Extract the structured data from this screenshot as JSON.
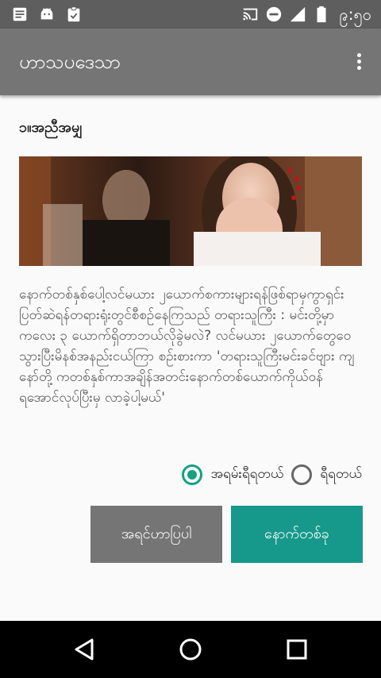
{
  "status_bar": {
    "time": "၉:၅၀",
    "icons_left": [
      "notes-icon",
      "android-icon",
      "clipboard-check-icon"
    ],
    "icons_right": [
      "cast-icon",
      "do-not-disturb-icon",
      "signal-icon",
      "battery-icon"
    ]
  },
  "app_bar": {
    "title": "ဟာသပဒေသာ",
    "menu_icon": "more-vert-icon"
  },
  "lesson": {
    "title": "၁။အညီအမျှ",
    "story": "နောက်တစ်နှစ်ပေါ့လင်မယား ၂ယောက်စကားများရန်ဖြစ်ရာမှကွာရှင်းပြတ်ဆဲရန်တရားရုံးတွင်စီစဥ်နေကြသည် တရားသူကြီး : မင်းတို့မှာကလေး ၃ ယောက်ရှိတာဘယ်လိုခွဲမလဲ? လင်မယား ၂ယောက်တွေဝေသွားပြီးမိနစ်အနည်းငယ်ကြာ စဥ်းစားကာ 'တရားသူကြီးမင်းခင်ဗျား ကျနော်တို့ ကတစ်နှစ်ကာအချိန်အတင်းနောက်တစ်ယောက်ကိုယ်ဝန်ရအောင်လုပ်ပြီးမှ လာခဲ့ပါ့မယ်'"
  },
  "choices": {
    "option1": "အရမ်းရီရတယ်",
    "option2": "ရီရတယ်",
    "selected": "option1"
  },
  "buttons": {
    "previous": "အရင်ဟာပြပါ",
    "next": "နောက်တစ်ခု"
  },
  "colors": {
    "app_bar": "#757575",
    "status_bar": "#5e5e5e",
    "accent": "#16998a",
    "button_gray": "#757575"
  },
  "nav_bar": {
    "icons": [
      "back-icon",
      "home-icon",
      "recents-icon"
    ]
  }
}
